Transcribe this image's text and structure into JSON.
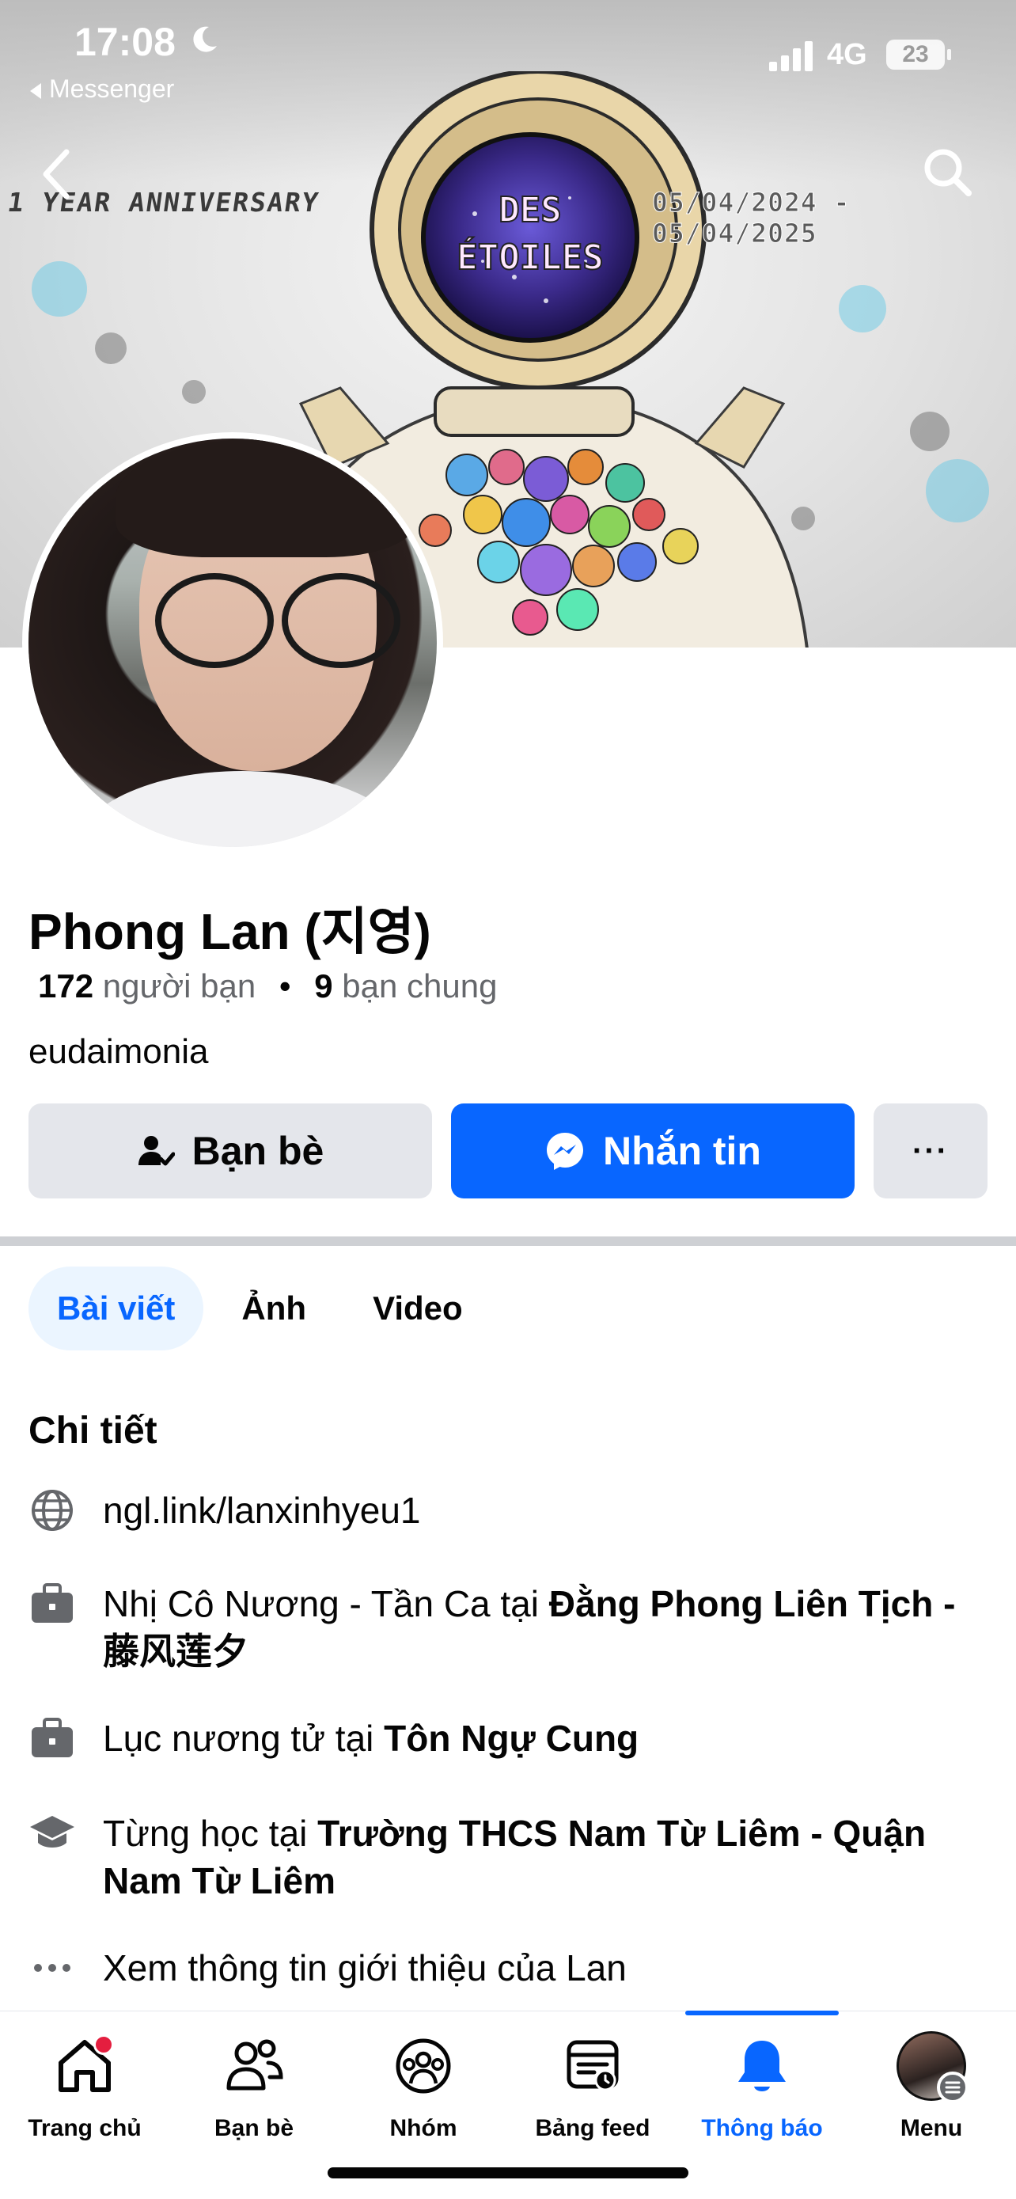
{
  "status_bar": {
    "time": "17:08",
    "back_app": "Messenger",
    "network": "4G",
    "battery": "23"
  },
  "cover": {
    "left_text": "1 YEAR ANNIVERSARY",
    "right_text": "05/04/2024 - 05/04/2025",
    "helmet_text": "DES ÉTOILES"
  },
  "profile": {
    "name": "Phong Lan (지영)",
    "friends_count": "172",
    "friends_label": "người bạn",
    "separator": "•",
    "mutual_count": "9",
    "mutual_label": "bạn chung",
    "bio": "eudaimonia"
  },
  "actions": {
    "friends": "Bạn bè",
    "message": "Nhắn tin",
    "more": "···"
  },
  "tabs": [
    "Bài viết",
    "Ảnh",
    "Video"
  ],
  "details": {
    "title": "Chi tiết",
    "link": "ngl.link/lanxinhyeu1",
    "work1_prefix": "Nhị Cô Nương - Tần Ca tại ",
    "work1_place": "Đằng Phong Liên Tịch - 藤风莲夕",
    "work2_prefix": "Lục nương tử tại ",
    "work2_place": "Tôn Ngự Cung",
    "edu_prefix": "Từng học tại ",
    "edu_place": "Trường THCS Nam Từ Liêm - Quận Nam Từ Liêm",
    "more": "Xem thông tin giới thiệu của Lan"
  },
  "bottom_nav": [
    {
      "label": "Trang chủ",
      "icon": "home-icon"
    },
    {
      "label": "Bạn bè",
      "icon": "friends-icon"
    },
    {
      "label": "Nhóm",
      "icon": "groups-icon"
    },
    {
      "label": "Bảng feed",
      "icon": "feed-icon"
    },
    {
      "label": "Thông báo",
      "icon": "bell-icon",
      "active": true
    },
    {
      "label": "Menu",
      "icon": "menu-avatar"
    }
  ],
  "colors": {
    "accent": "#0866ff",
    "button_gray": "#e4e6eb",
    "secondary_text": "#65676b",
    "notification_dot": "#e41e3f"
  }
}
